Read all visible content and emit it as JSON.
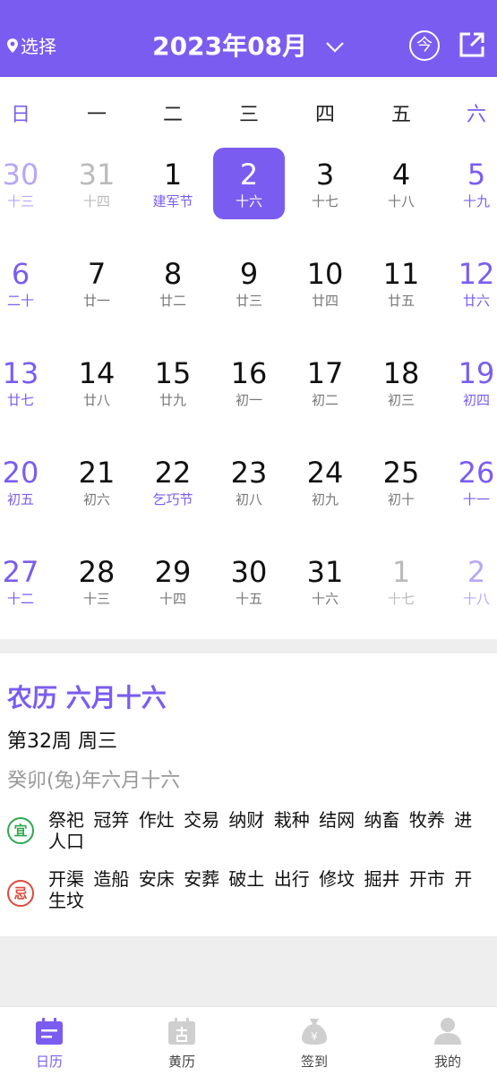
{
  "header": {
    "location_label": "选择",
    "month_title": "2023年08月",
    "today_label": "今",
    "accent_color": "#7b5cf0",
    "icons": [
      "location-pin-icon",
      "chevron-down-icon",
      "share-icon"
    ]
  },
  "weekdays": [
    "日",
    "一",
    "二",
    "三",
    "四",
    "五",
    "六"
  ],
  "calendar": {
    "weeks": [
      [
        {
          "day": "30",
          "sub": "十三"
        },
        {
          "day": "31",
          "sub": "十四"
        },
        {
          "day": "1",
          "sub": "建军节"
        },
        {
          "day": "2",
          "sub": "十六"
        },
        {
          "day": "3",
          "sub": "十七"
        },
        {
          "day": "4",
          "sub": "十八"
        },
        {
          "day": "5",
          "sub": "十九"
        }
      ],
      [
        {
          "day": "6",
          "sub": "二十"
        },
        {
          "day": "7",
          "sub": "廿一"
        },
        {
          "day": "8",
          "sub": "廿二"
        },
        {
          "day": "9",
          "sub": "廿三"
        },
        {
          "day": "10",
          "sub": "廿四"
        },
        {
          "day": "11",
          "sub": "廿五"
        },
        {
          "day": "12",
          "sub": "廿六"
        }
      ],
      [
        {
          "day": "13",
          "sub": "廿七"
        },
        {
          "day": "14",
          "sub": "廿八"
        },
        {
          "day": "15",
          "sub": "廿九"
        },
        {
          "day": "16",
          "sub": "初一"
        },
        {
          "day": "17",
          "sub": "初二"
        },
        {
          "day": "18",
          "sub": "初三"
        },
        {
          "day": "19",
          "sub": "初四"
        }
      ],
      [
        {
          "day": "20",
          "sub": "初五"
        },
        {
          "day": "21",
          "sub": "初六"
        },
        {
          "day": "22",
          "sub": "乞巧节"
        },
        {
          "day": "23",
          "sub": "初八"
        },
        {
          "day": "24",
          "sub": "初九"
        },
        {
          "day": "25",
          "sub": "初十"
        },
        {
          "day": "26",
          "sub": "十一"
        }
      ],
      [
        {
          "day": "27",
          "sub": "十二"
        },
        {
          "day": "28",
          "sub": "十三"
        },
        {
          "day": "29",
          "sub": "十四"
        },
        {
          "day": "30",
          "sub": "十五"
        },
        {
          "day": "31",
          "sub": "十六"
        },
        {
          "day": "1",
          "sub": "十七"
        },
        {
          "day": "2",
          "sub": "十八"
        }
      ]
    ]
  },
  "detail": {
    "lunar_title": "农历 六月十六",
    "week_info": "第32周 周三",
    "ganzhi": "癸卯(兔)年六月十六",
    "yi_label": "宜",
    "yi_items": "祭祀 冠笄 作灶 交易 纳财 栽种 结网 纳畜 牧养 进人口",
    "ji_label": "忌",
    "ji_items": "开渠 造船 安床 安葬 破土 出行 修坟 掘井 开市 开生坟"
  },
  "tabs": [
    {
      "label": "日历",
      "icon": "calendar-icon"
    },
    {
      "label": "黄历",
      "icon": "almanac-icon"
    },
    {
      "label": "签到",
      "icon": "money-bag-icon"
    },
    {
      "label": "我的",
      "icon": "user-icon"
    }
  ]
}
